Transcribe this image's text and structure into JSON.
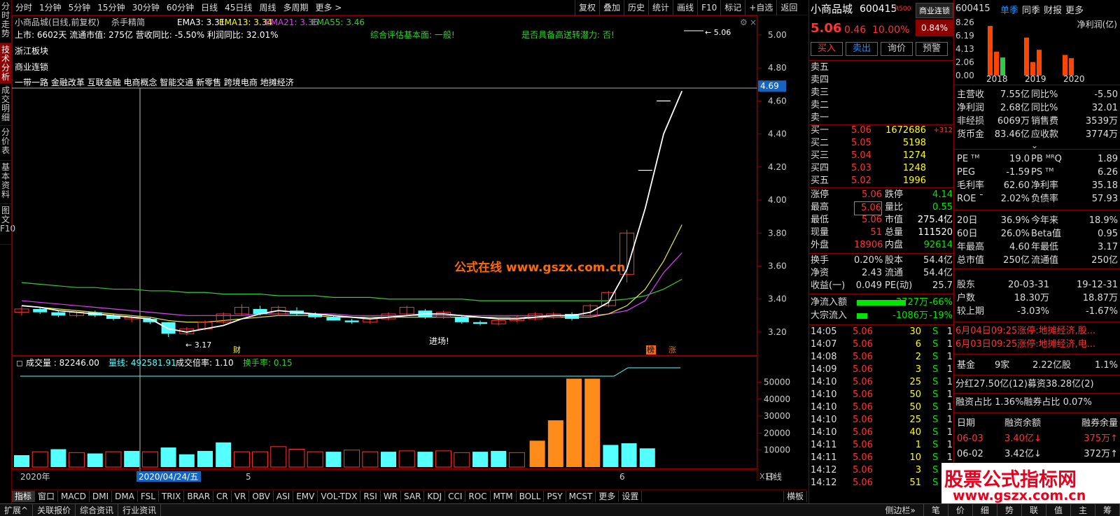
{
  "left_tabs": [
    "分时走势",
    "技术分析",
    "成交明细",
    "分价表",
    "基本资料",
    "图文F10"
  ],
  "toolbar": {
    "items": [
      "分时",
      "1分钟",
      "5分钟",
      "15分钟",
      "30分钟",
      "60分钟",
      "日线",
      "45日线",
      "周线",
      "多周期",
      "更多 >"
    ],
    "right": [
      "复权",
      "叠加",
      "历史",
      "统计",
      "画线",
      "F10",
      "标记",
      "+自选",
      "返回"
    ]
  },
  "chart_header": {
    "title": "小商品城(日线,前复权)",
    "indicator_name": "杀手精简",
    "ema3": "EMA3: 3.31",
    "ema13": "EMA13: 3.34",
    "ema21": "EMA21: 3.36",
    "ema55": "EMA55: 3.46",
    "line2_a": "上市: 6602天   流通市值: 275亿   营收同比: -5.50%   利润同比: 32.01%",
    "eval": "综合评估基本面: 一般!",
    "potential": "是否具备高送转潜力: 否!",
    "sector": "浙江板块",
    "industry": "商业连锁",
    "concepts": "一带一路 金融改革 互联金融 电商概念 智能交通 新零售 跨境电商 地摊经济",
    "price_tag": "4.69",
    "high_label": "5.06",
    "low_label": "3.17",
    "entry_label": "进场!",
    "watermark": "公式在线  www.gszx.com.cn",
    "tag_cai": "财",
    "tag_bang": "榜",
    "tag_zhang": "涨"
  },
  "chart_data": {
    "type": "candlestick",
    "y_ticks": [
      "5.00",
      "4.80",
      "4.60",
      "4.40",
      "4.20",
      "4.00",
      "3.80",
      "3.60",
      "3.40",
      "3.20"
    ],
    "ylim": [
      3.06,
      5.11
    ],
    "candles": [
      {
        "o": 3.32,
        "c": 3.34,
        "h": 3.36,
        "l": 3.3
      },
      {
        "o": 3.34,
        "c": 3.32,
        "h": 3.35,
        "l": 3.31
      },
      {
        "o": 3.32,
        "c": 3.3,
        "h": 3.33,
        "l": 3.29
      },
      {
        "o": 3.3,
        "c": 3.32,
        "h": 3.33,
        "l": 3.29
      },
      {
        "o": 3.32,
        "c": 3.3,
        "h": 3.33,
        "l": 3.29
      },
      {
        "o": 3.3,
        "c": 3.28,
        "h": 3.31,
        "l": 3.27
      },
      {
        "o": 3.28,
        "c": 3.29,
        "h": 3.3,
        "l": 3.26
      },
      {
        "o": 3.28,
        "c": 3.26,
        "h": 3.29,
        "l": 3.25
      },
      {
        "o": 3.26,
        "c": 3.19,
        "h": 3.26,
        "l": 3.17
      },
      {
        "o": 3.19,
        "c": 3.22,
        "h": 3.23,
        "l": 3.18
      },
      {
        "o": 3.22,
        "c": 3.26,
        "h": 3.27,
        "l": 3.21
      },
      {
        "o": 3.26,
        "c": 3.31,
        "h": 3.32,
        "l": 3.25
      },
      {
        "o": 3.31,
        "c": 3.35,
        "h": 3.37,
        "l": 3.3
      },
      {
        "o": 3.34,
        "c": 3.31,
        "h": 3.36,
        "l": 3.3
      },
      {
        "o": 3.31,
        "c": 3.35,
        "h": 3.36,
        "l": 3.3
      },
      {
        "o": 3.33,
        "c": 3.31,
        "h": 3.35,
        "l": 3.3
      },
      {
        "o": 3.31,
        "c": 3.29,
        "h": 3.32,
        "l": 3.28
      },
      {
        "o": 3.29,
        "c": 3.27,
        "h": 3.3,
        "l": 3.27
      },
      {
        "o": 3.27,
        "c": 3.26,
        "h": 3.28,
        "l": 3.25
      },
      {
        "o": 3.26,
        "c": 3.28,
        "h": 3.29,
        "l": 3.25
      },
      {
        "o": 3.28,
        "c": 3.31,
        "h": 3.32,
        "l": 3.27
      },
      {
        "o": 3.31,
        "c": 3.35,
        "h": 3.36,
        "l": 3.3
      },
      {
        "o": 3.33,
        "c": 3.29,
        "h": 3.34,
        "l": 3.28
      },
      {
        "o": 3.29,
        "c": 3.32,
        "h": 3.33,
        "l": 3.28
      },
      {
        "o": 3.29,
        "c": 3.26,
        "h": 3.3,
        "l": 3.25
      },
      {
        "o": 3.26,
        "c": 3.25,
        "h": 3.27,
        "l": 3.24
      },
      {
        "o": 3.25,
        "c": 3.27,
        "h": 3.28,
        "l": 3.24
      },
      {
        "o": 3.27,
        "c": 3.29,
        "h": 3.3,
        "l": 3.26
      },
      {
        "o": 3.28,
        "c": 3.31,
        "h": 3.32,
        "l": 3.27
      },
      {
        "o": 3.29,
        "c": 3.31,
        "h": 3.32,
        "l": 3.28
      },
      {
        "o": 3.31,
        "c": 3.28,
        "h": 3.32,
        "l": 3.27
      },
      {
        "o": 3.3,
        "c": 3.36,
        "h": 3.37,
        "l": 3.29
      },
      {
        "o": 3.36,
        "c": 3.44,
        "h": 3.45,
        "l": 3.35
      },
      {
        "o": 3.55,
        "c": 3.8,
        "h": 3.82,
        "l": 3.5
      },
      {
        "o": 4.18,
        "c": 4.18,
        "h": 4.18,
        "l": 4.18
      },
      {
        "o": 4.6,
        "c": 4.6,
        "h": 4.6,
        "l": 4.6
      }
    ],
    "white_line": [
      3.36,
      3.35,
      3.33,
      3.32,
      3.31,
      3.3,
      3.29,
      3.28,
      3.22,
      3.2,
      3.22,
      3.24,
      3.28,
      3.31,
      3.33,
      3.32,
      3.31,
      3.3,
      3.29,
      3.28,
      3.29,
      3.3,
      3.31,
      3.31,
      3.3,
      3.29,
      3.28,
      3.28,
      3.29,
      3.3,
      3.3,
      3.32,
      3.38,
      3.58,
      3.95,
      4.4,
      4.66
    ],
    "ema21_line": [
      3.39,
      3.38,
      3.37,
      3.36,
      3.35,
      3.34,
      3.33,
      3.32,
      3.31,
      3.3,
      3.3,
      3.3,
      3.3,
      3.31,
      3.31,
      3.31,
      3.31,
      3.31,
      3.3,
      3.3,
      3.3,
      3.3,
      3.3,
      3.3,
      3.3,
      3.3,
      3.3,
      3.3,
      3.3,
      3.3,
      3.3,
      3.3,
      3.31,
      3.33,
      3.39,
      3.56,
      3.68
    ],
    "ema13_line": [
      3.36,
      3.35,
      3.34,
      3.33,
      3.32,
      3.31,
      3.3,
      3.29,
      3.27,
      3.26,
      3.26,
      3.27,
      3.28,
      3.29,
      3.3,
      3.3,
      3.3,
      3.29,
      3.29,
      3.29,
      3.29,
      3.29,
      3.29,
      3.29,
      3.29,
      3.29,
      3.29,
      3.29,
      3.29,
      3.29,
      3.29,
      3.29,
      3.31,
      3.36,
      3.46,
      3.63,
      3.85
    ],
    "ema55_line": [
      3.5,
      3.49,
      3.48,
      3.47,
      3.47,
      3.46,
      3.46,
      3.45,
      3.45,
      3.44,
      3.44,
      3.43,
      3.43,
      3.43,
      3.42,
      3.42,
      3.42,
      3.41,
      3.41,
      3.41,
      3.4,
      3.4,
      3.4,
      3.4,
      3.4,
      3.39,
      3.39,
      3.39,
      3.39,
      3.39,
      3.39,
      3.39,
      3.39,
      3.4,
      3.42,
      3.46,
      3.52
    ],
    "volume_header": {
      "vol": "成交量 : 82246.00",
      "ma": "量线: 492581.91",
      "ratio": "成交倍率: 1.10",
      "turnover": "换手率: 0.15"
    },
    "vol_ticks": [
      "50000",
      "40000",
      "30000",
      "20000",
      "10000"
    ],
    "vol_ylim": [
      0,
      58000
    ],
    "volumes": [
      {
        "v": 7000,
        "up": true
      },
      {
        "v": 9000,
        "up": false
      },
      {
        "v": 10500,
        "up": true
      },
      {
        "v": 8500,
        "up": false
      },
      {
        "v": 8000,
        "up": true
      },
      {
        "v": 9000,
        "up": false
      },
      {
        "v": 9500,
        "up": true
      },
      {
        "v": 9000,
        "up": false
      },
      {
        "v": 11500,
        "up": true
      },
      {
        "v": 7500,
        "up": true
      },
      {
        "v": 9500,
        "up": true
      },
      {
        "v": 14500,
        "up": true
      },
      {
        "v": 9000,
        "up": false
      },
      {
        "v": 9000,
        "up": false
      },
      {
        "v": 12000,
        "up": false
      },
      {
        "v": 10500,
        "up": false
      },
      {
        "v": 9000,
        "up": false
      },
      {
        "v": 9000,
        "up": true
      },
      {
        "v": 10000,
        "up": false
      },
      {
        "v": 9000,
        "up": false
      },
      {
        "v": 9000,
        "up": true
      },
      {
        "v": 9500,
        "up": false
      },
      {
        "v": 9000,
        "up": true
      },
      {
        "v": 9500,
        "up": false
      },
      {
        "v": 8500,
        "up": false
      },
      {
        "v": 9000,
        "up": true
      },
      {
        "v": 9500,
        "up": true
      },
      {
        "v": 8500,
        "up": false
      },
      {
        "v": 15500,
        "up": true
      },
      {
        "v": 27500,
        "up": true
      },
      {
        "v": 52000,
        "up": true
      },
      {
        "v": 52000,
        "up": true
      },
      {
        "v": 13000,
        "up": true
      },
      {
        "v": 14000,
        "up": true
      },
      {
        "v": 11000,
        "up": true
      }
    ],
    "x_labels": {
      "year": "2020年",
      "date": "2020/04/24/五",
      "m5": "5",
      "m6": "6"
    },
    "x10": "X10",
    "daily": "日线"
  },
  "bottom_tabs": [
    "指标",
    "窗口",
    "MACD",
    "DMI",
    "DMA",
    "FSL",
    "TRIX",
    "BRAR",
    "CR",
    "VR",
    "OBV",
    "ASI",
    "EMV",
    "VOL-TDX",
    "RSI",
    "WR",
    "SAR",
    "KDJ",
    "CCI",
    "ROC",
    "MTM",
    "BOLL",
    "PSY",
    "MCST",
    "更多",
    "设置"
  ],
  "bottom_right_tab": "横板",
  "status_bar": [
    "扩展^",
    "关联报价",
    "综合资讯",
    "行业资讯"
  ],
  "status_right": [
    "侧边栏»",
    "笔",
    "价",
    "细",
    "势",
    "联",
    "值",
    "主",
    "筹"
  ],
  "quote": {
    "name": "小商品城",
    "code": "600415",
    "badge": "R500",
    "sector_btn": "商业连锁",
    "sector_pct": "0.84%",
    "price": "5.06",
    "change": "0.46",
    "pct": "10.00%",
    "buttons": [
      "买入",
      "卖出",
      "询价",
      "预警"
    ],
    "sell": [
      "卖五",
      "卖四",
      "卖三",
      "卖二",
      "卖一"
    ],
    "buy": [
      {
        "label": "买一",
        "price": "5.06",
        "vol": "1672686",
        "extra": "+312"
      },
      {
        "label": "买二",
        "price": "5.05",
        "vol": "5198",
        "extra": ""
      },
      {
        "label": "买三",
        "price": "5.04",
        "vol": "1274",
        "extra": ""
      },
      {
        "label": "买四",
        "price": "5.03",
        "vol": "1248",
        "extra": ""
      },
      {
        "label": "买五",
        "price": "5.02",
        "vol": "1996",
        "extra": ""
      }
    ],
    "stats": [
      [
        "涨停",
        "5.06",
        "跌停",
        "4.14"
      ],
      [
        "最高",
        "5.06",
        "量比",
        "0.55"
      ],
      [
        "最低",
        "5.06",
        "市值",
        "275.4亿"
      ],
      [
        "现量",
        "51",
        "总量",
        "111520"
      ],
      [
        "外盘",
        "18906",
        "内盘",
        "92614"
      ]
    ],
    "stats2": [
      [
        "换手",
        "0.20%",
        "股本",
        "54.4亿"
      ],
      [
        "净资",
        "2.43",
        "流通",
        "54.4亿"
      ],
      [
        "收益(一)",
        "0.049",
        "PE(动)",
        "25.7"
      ]
    ],
    "flow": [
      {
        "label": "净流入额",
        "val": "-3727万",
        "pct": "-66%",
        "bar": 0.92
      },
      {
        "label": "大宗流入",
        "val": "-1086万",
        "pct": "-19%",
        "bar": 0.2
      }
    ],
    "ticks": [
      [
        "14:05",
        "5.06",
        "30",
        "S",
        "1"
      ],
      [
        "14:07",
        "5.06",
        "6",
        "S",
        "1"
      ],
      [
        "14:08",
        "5.06",
        "2",
        "S",
        "1"
      ],
      [
        "14:09",
        "5.06",
        "3",
        "S",
        "1"
      ],
      [
        "14:10",
        "5.06",
        "25",
        "S",
        "1"
      ],
      [
        "14:10",
        "5.06",
        "50",
        "S",
        "1"
      ],
      [
        "14:10",
        "5.06",
        "50",
        "S",
        "1"
      ],
      [
        "14:10",
        "5.06",
        "25",
        "S",
        "1"
      ],
      [
        "14:10",
        "5.06",
        "40",
        "S",
        "1"
      ],
      [
        "14:11",
        "5.06",
        "1",
        "S",
        "1"
      ],
      [
        "14:11",
        "5.06",
        "10",
        "S",
        "1"
      ],
      [
        "14:12",
        "5.06",
        "3",
        "S",
        "1"
      ],
      [
        "14:12",
        "5.06",
        "51",
        "S",
        "1"
      ]
    ]
  },
  "fin": {
    "code": "600415",
    "tabs": [
      "单季",
      "同季",
      "财报",
      "更多"
    ],
    "chart_title": "净利润(亿)",
    "yticks": [
      "8.26",
      "6.19",
      "4.13",
      "2.06",
      "0.00"
    ],
    "years": [
      "2018",
      "2019",
      "2020"
    ],
    "bars": [
      {
        "v": 7.7,
        "c": "#ff4500"
      },
      {
        "v": 3.7,
        "c": "#ff4500"
      },
      {
        "v": 2.8,
        "c": "#2ecc40"
      },
      {
        "v": 5.9,
        "c": "#ff4500"
      },
      {
        "v": 2.1,
        "c": "#ff4500"
      },
      {
        "v": 4.0,
        "c": "#ff4500"
      },
      {
        "v": 3.2,
        "c": "#ff4500"
      },
      {
        "v": 2.7,
        "c": "#ff4500"
      }
    ],
    "rows": [
      [
        "主营收",
        "7.55亿",
        "同比%",
        "-5.50"
      ],
      [
        "净利润",
        "2.68亿",
        "同比%",
        "32.01"
      ],
      [
        "非经损",
        "6069万",
        "销售费",
        "3539万"
      ],
      [
        "货币金",
        "83.46亿",
        "应收款",
        "3774万"
      ]
    ],
    "rows2": [
      [
        "PE ᵀᴹ",
        "19.0",
        "PB ᴹᴿQ",
        "1.89"
      ],
      [
        "PEG",
        "-1.59",
        "PS ᵀᴹ",
        "6.26"
      ],
      [
        "毛利率",
        "62.60",
        "净利率",
        "35.18"
      ],
      [
        "ROE ¯",
        "2.02%",
        "负债率",
        "57.93"
      ]
    ],
    "rows3": [
      [
        "20日",
        "36.9%",
        "今年来",
        "18.9%"
      ],
      [
        "60日",
        "26.0%",
        "Beta值",
        "0.95"
      ],
      [
        "年最高",
        "4.60",
        "年最低",
        "3.17"
      ],
      [
        "总市值",
        "250亿",
        "流通值",
        "250亿"
      ]
    ],
    "holder": [
      [
        "股东",
        "20-03-31",
        "19-12-31"
      ],
      [
        "户数",
        "18.30万",
        "18.87万"
      ],
      [
        "较上期",
        "-3.03%",
        "-1.67%"
      ]
    ],
    "news": [
      "6月04日09:25涨停:地摊经济,股...",
      "6月03日09:25涨停:地摊经济,电..."
    ],
    "fund": [
      "基金",
      "9家",
      "2.22亿股",
      "1.1%"
    ],
    "fenhong": "分红27.50亿(12)募资38.28亿(2)",
    "margin_ratio": "融资占比 1.36%融券占比 0.07%",
    "margin_head": [
      "日期",
      "融资余额",
      "融券余量"
    ],
    "margin": [
      [
        "06-03",
        "3.40亿↓",
        "375万↑"
      ],
      [
        "06-02",
        "3.42亿↓",
        "372万↑"
      ]
    ],
    "ad": "股票公式指标网",
    "ad2": "www.gszx.com.cn"
  }
}
